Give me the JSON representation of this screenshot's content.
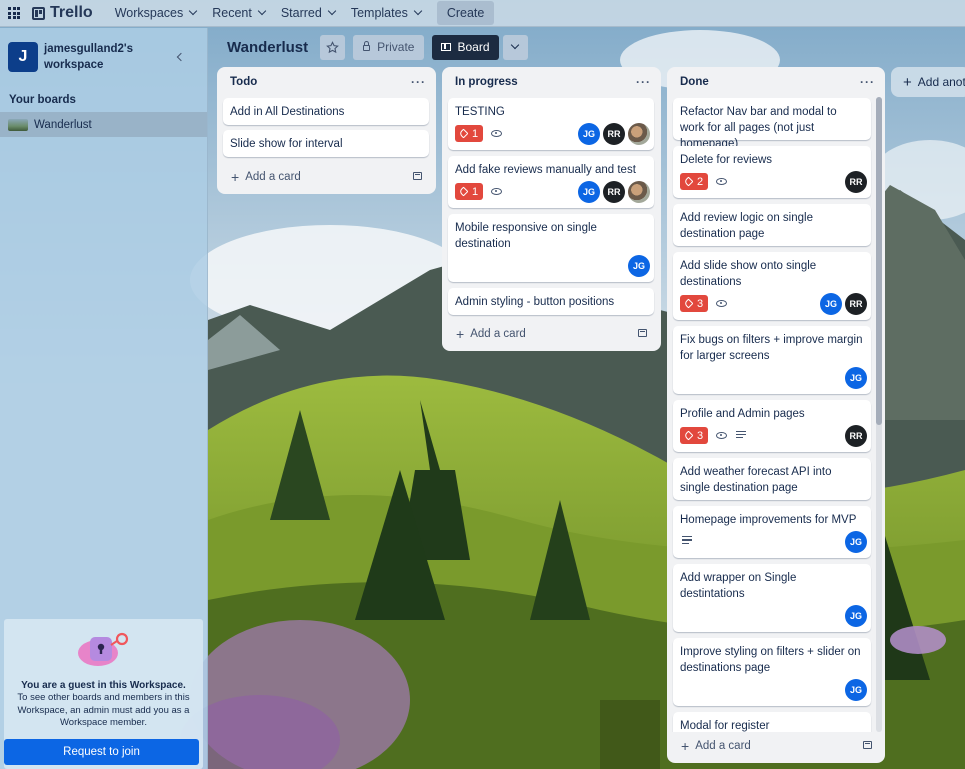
{
  "nav": {
    "logo": "Trello",
    "items": [
      "Workspaces",
      "Recent",
      "Starred",
      "Templates"
    ],
    "create": "Create"
  },
  "sidebar": {
    "avatar_letter": "J",
    "workspace_name": "jamesgulland2's workspace",
    "your_boards": "Your boards",
    "board": "Wanderlust",
    "guest_title": "You are a guest in this Workspace.",
    "guest_text": "To see other boards and members in this Workspace, an admin must add you as a Workspace member.",
    "join": "Request to join"
  },
  "board": {
    "title": "Wanderlust",
    "visibility": "Private",
    "view": "Board"
  },
  "lists": [
    {
      "title": "Todo",
      "cards": [
        {
          "title": "Add in All Destinations"
        },
        {
          "title": "Slide show for interval"
        }
      ],
      "add_card": "Add a card"
    },
    {
      "title": "In progress",
      "cards": [
        {
          "title": "TESTING",
          "badge": "1",
          "watch": true,
          "members": [
            "JG",
            "RR",
            "photo"
          ]
        },
        {
          "title": "Add fake reviews manually and test",
          "badge": "1",
          "watch": true,
          "members": [
            "JG",
            "RR",
            "photo"
          ]
        },
        {
          "title": "Mobile responsive on single destination",
          "members": [
            "JG"
          ]
        },
        {
          "title": "Admin styling - button positions"
        }
      ],
      "add_card": "Add a card"
    },
    {
      "title": "Done",
      "cards": [
        {
          "title": "Refactor Nav bar and modal to work for all pages (not just homepage)"
        },
        {
          "title": "Delete for reviews",
          "badge": "2",
          "watch": true,
          "members": [
            "RR"
          ]
        },
        {
          "title": "Add review logic on single destination page"
        },
        {
          "title": "Add slide show onto single destinations",
          "badge": "3",
          "watch": true,
          "members": [
            "JG",
            "RR"
          ]
        },
        {
          "title": "Fix bugs on filters + improve margin for larger screens",
          "members": [
            "JG"
          ]
        },
        {
          "title": "Profile and Admin pages",
          "badge": "3",
          "watch": true,
          "description": true,
          "members": [
            "RR"
          ]
        },
        {
          "title": "Add weather forecast API into single destination page"
        },
        {
          "title": "Homepage improvements for MVP",
          "description": true,
          "members": [
            "JG"
          ]
        },
        {
          "title": "Add wrapper on Single destintations",
          "members": [
            "JG"
          ]
        },
        {
          "title": "Improve styling on filters + slider on destinations page",
          "members": [
            "JG"
          ]
        },
        {
          "title": "Modal for register"
        }
      ],
      "add_card": "Add a card"
    }
  ],
  "add_list": "Add anot",
  "colors": {
    "brand_blue": "#0c66e4",
    "badge_red": "#e2483d",
    "board_button": "#1c2b41"
  }
}
